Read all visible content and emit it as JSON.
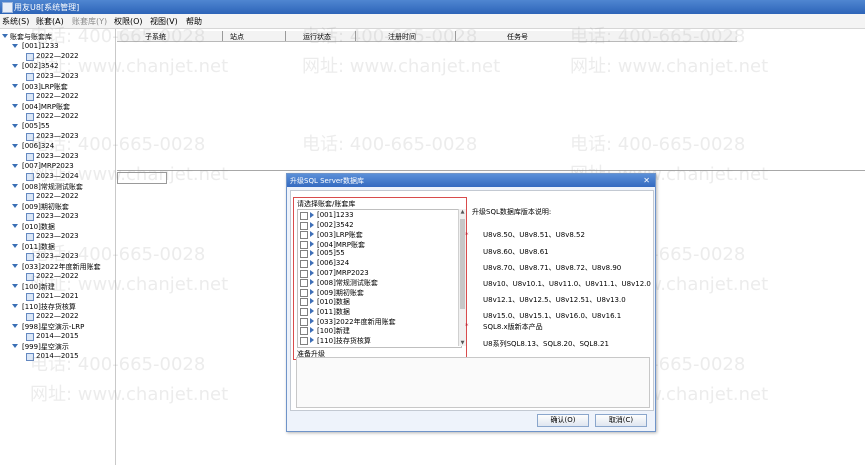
{
  "window": {
    "title": "用友U8[系统管理]"
  },
  "menu": [
    "系统(S)",
    "账套(A)",
    "账套库(Y)",
    "权限(O)",
    "视图(V)",
    "帮助"
  ],
  "tree": {
    "root": "账套与账套库",
    "accounts": [
      {
        "name": "[001]1233",
        "period": "2022—2022"
      },
      {
        "name": "[002]3542",
        "period": "2023—2023"
      },
      {
        "name": "[003]LRP账套",
        "period": "2022—2022"
      },
      {
        "name": "[004]MRP账套",
        "period": "2022—2022"
      },
      {
        "name": "[005]55",
        "period": "2023—2023"
      },
      {
        "name": "[006]324",
        "period": "2023—2023"
      },
      {
        "name": "[007]MRP2023",
        "period": "2023—2024"
      },
      {
        "name": "[008]常规测试账套",
        "period": "2022—2022"
      },
      {
        "name": "[009]期初账套",
        "period": "2023—2023"
      },
      {
        "name": "[010]数据",
        "period": "2023—2023"
      },
      {
        "name": "[011]数据",
        "period": "2023—2023"
      },
      {
        "name": "[033]2022年度新用账套",
        "period": "2022—2022"
      },
      {
        "name": "[100]新建",
        "period": "2021—2021"
      },
      {
        "name": "[110]技存货核算",
        "period": "2022—2022"
      },
      {
        "name": "[998]星空演示-LRP",
        "period": "2014—2015"
      },
      {
        "name": "[999]星空演示",
        "period": "2014—2015"
      }
    ]
  },
  "grid": {
    "columns": [
      "子系统",
      "站点",
      "运行状态",
      "注册时间",
      "任务号"
    ]
  },
  "watermark": {
    "phone": "电话: 400-665-0028",
    "site": "网址: www.chanjet.net"
  },
  "dialog": {
    "title": "升级SQL Server数据库",
    "close": "✕",
    "select_label": "请选择账套/账套库",
    "list": [
      "[001]1233",
      "[002]3542",
      "[003]LRP账套",
      "[004]MRP账套",
      "[005]55",
      "[006]324",
      "[007]MRP2023",
      "[008]常规测试账套",
      "[009]期初账套",
      "[010]数据",
      "[011]数据",
      "[033]2022年度新用账套",
      "[100]新建",
      "[110]技存货核算"
    ],
    "note_title": "升级SQL数据库版本说明:",
    "star": "*",
    "versions": [
      "U8v8.50、U8v8.51、U8v8.52",
      "U8v8.60、U8v8.61",
      "U8v8.70、U8v8.71、U8v8.72、U8v8.90",
      "U8v10、U8v10.1、U8v11.0、U8v11.1、U8v12.0",
      "U8v12.1、U8v12.5、U8v12.51、U8v13.0",
      "U8v15.0、U8v15.1、U8v16.0、U8v16.1",
      "SQL8.x版新本产品",
      "U8系列SQL8.13、SQL8.20、SQL8.21"
    ],
    "status": "准备升级",
    "ok": "确认(O)",
    "cancel": "取消(C)"
  }
}
